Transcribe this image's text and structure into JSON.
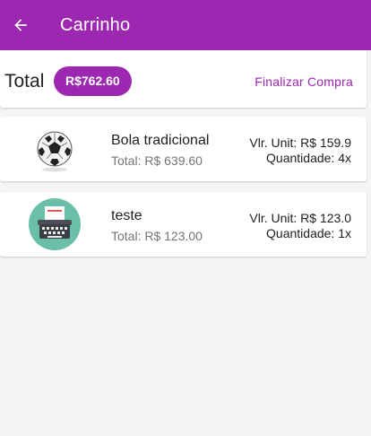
{
  "appbar": {
    "title": "Carrinho",
    "back_icon": "arrow-left-icon",
    "background": "#9c27b0"
  },
  "summary": {
    "label": "Total",
    "amount": "R$762.60",
    "checkout": "Finalizar Compra"
  },
  "items": [
    {
      "name": "Bola tradicional",
      "total": "Total: R$ 639.60",
      "unit": "Vlr. Unit: R$ 159.9",
      "quantity": "Quantidade: 4x",
      "icon": "soccer-ball-icon"
    },
    {
      "name": "teste",
      "total": "Total: R$ 123.00",
      "unit": "Vlr. Unit: R$ 123.0",
      "quantity": "Quantidade: 1x",
      "icon": "typewriter-icon"
    }
  ],
  "colors": {
    "accent": "#9c27b0",
    "background": "#f5f5f5"
  }
}
